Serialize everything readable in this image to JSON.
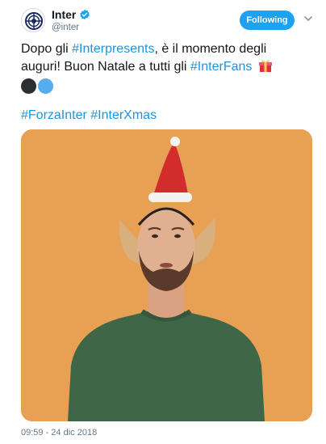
{
  "account": {
    "name": "Inter",
    "handle": "@inter"
  },
  "follow_button": {
    "label": "Following"
  },
  "tweet": {
    "line1_prefix": "Dopo gli ",
    "hashtag_interpresents": "#Interpresents",
    "line1_suffix": ", è il momento degli auguri! Buon Natale a tutti gli ",
    "hashtag_interfans": "#InterFans",
    "hashtag_forzainter": "#ForzaInter",
    "hashtag_interxmas": "#InterXmas"
  },
  "media": {
    "background_color": "#e8a055",
    "description_icon": "video-thumbnail"
  },
  "timestamp": "09:59 - 24 dic 2018",
  "colors": {
    "accent": "#1da1f2",
    "link": "#1b95e0",
    "muted": "#657786"
  }
}
